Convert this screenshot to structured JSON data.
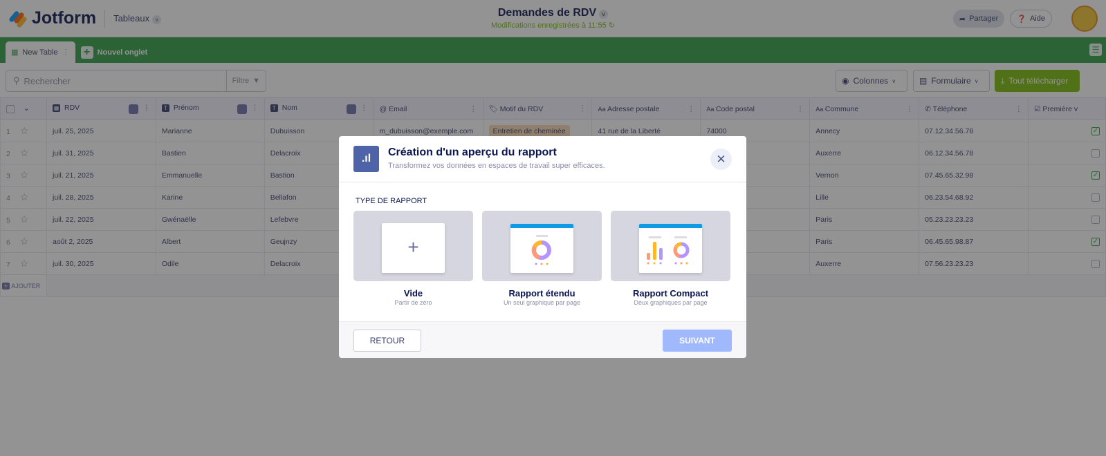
{
  "header": {
    "brand": "Jotform",
    "section": "Tableaux",
    "title": "Demandes de RDV",
    "status": "Modifications enregistrées à 11:55",
    "share": "Partager",
    "help": "Aide"
  },
  "tabs": {
    "active": "New Table",
    "new": "Nouvel onglet"
  },
  "toolbar": {
    "search_placeholder": "Rechercher",
    "filter": "Filtre",
    "columns": "Colonnes",
    "form": "Formulaire",
    "download": "Tout télécharger"
  },
  "table": {
    "columns": [
      "RDV",
      "Prénom",
      "Nom",
      "Email",
      "Motif du RDV",
      "Adresse postale",
      "Code postal",
      "Commune",
      "Téléphone",
      "Première v"
    ],
    "rows": [
      {
        "n": "1",
        "rdv": "juil. 25, 2025",
        "prenom": "Marianne",
        "nom": "Dubuisson",
        "email": "m_dubuisson@exemple.com",
        "motif": "Entretien de cheminée",
        "adresse": "41 rue de la Liberté",
        "cp": "74000",
        "commune": "Annecy",
        "tel": "07.12.34.56.78",
        "first": true
      },
      {
        "n": "2",
        "rdv": "juil. 31, 2025",
        "prenom": "Bastien",
        "nom": "Delacroix",
        "commune": "Auxerre",
        "tel": "06.12.34.56.78",
        "first": false
      },
      {
        "n": "3",
        "rdv": "juil. 21, 2025",
        "prenom": "Emmanuelle",
        "nom": "Bastion",
        "commune": "Vernon",
        "tel": "07.45.65.32.98",
        "first": true
      },
      {
        "n": "4",
        "rdv": "juil. 28, 2025",
        "prenom": "Karine",
        "nom": "Bellafon",
        "commune": "Lille",
        "tel": "06.23.54.68.92",
        "first": false
      },
      {
        "n": "5",
        "rdv": "juil. 22, 2025",
        "prenom": "Gwénaëlle",
        "nom": "Lefebvre",
        "commune": "Paris",
        "tel": "05.23.23.23.23",
        "first": false
      },
      {
        "n": "6",
        "rdv": "août 2, 2025",
        "prenom": "Albert",
        "nom": "Geujnzy",
        "commune": "Paris",
        "tel": "06.45.65.98.87",
        "first": true
      },
      {
        "n": "7",
        "rdv": "juil. 30, 2025",
        "prenom": "Odile",
        "nom": "Delacroix",
        "commune": "Auxerre",
        "tel": "07.56.23.23.23",
        "first": false
      }
    ],
    "add": "AJOUTER"
  },
  "modal": {
    "title": "Création d'un aperçu du rapport",
    "subtitle": "Transformez vos données en espaces de travail super efficaces.",
    "section": "TYPE DE RAPPORT",
    "cards": [
      {
        "title": "Vide",
        "subtitle": "Partir de zéro"
      },
      {
        "title": "Rapport étendu",
        "subtitle": "Un seul graphique par page"
      },
      {
        "title": "Rapport Compact",
        "subtitle": "Deux graphiques par page"
      }
    ],
    "back": "RETOUR",
    "next": "SUIVANT"
  }
}
